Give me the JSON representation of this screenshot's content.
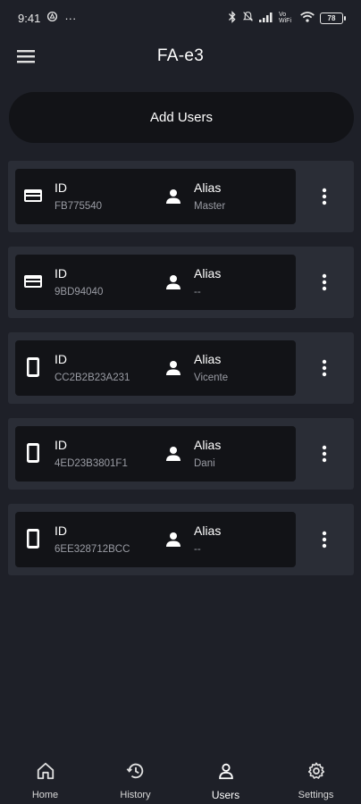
{
  "status_bar": {
    "time": "9:41",
    "overflow": "···",
    "network_label": "Vo WiFi",
    "battery": "78"
  },
  "app_bar": {
    "title": "FA-e3",
    "menu_icon": "hamburger-menu-icon"
  },
  "add_users": {
    "label": "Add Users"
  },
  "users": [
    {
      "type_icon": "card-icon",
      "id_label": "ID",
      "id_value": "FB775540",
      "alias_label": "Alias",
      "alias_value": "Master"
    },
    {
      "type_icon": "card-icon",
      "id_label": "ID",
      "id_value": "9BD94040",
      "alias_label": "Alias",
      "alias_value": "--"
    },
    {
      "type_icon": "phone-icon",
      "id_label": "ID",
      "id_value": "CC2B2B23A231",
      "alias_label": "Alias",
      "alias_value": "Vicente"
    },
    {
      "type_icon": "phone-icon",
      "id_label": "ID",
      "id_value": "4ED23B3801F1",
      "alias_label": "Alias",
      "alias_value": "Dani"
    },
    {
      "type_icon": "phone-icon",
      "id_label": "ID",
      "id_value": "6EE328712BCC",
      "alias_label": "Alias",
      "alias_value": "--"
    }
  ],
  "bottom_nav": {
    "items": [
      {
        "label": "Home",
        "icon": "home-icon"
      },
      {
        "label": "History",
        "icon": "history-icon"
      },
      {
        "label": "Users",
        "icon": "person-icon"
      },
      {
        "label": "Settings",
        "icon": "gear-icon"
      }
    ],
    "active": "Users"
  },
  "colors": {
    "background": "#1e2028",
    "card_outer": "#2a2d36",
    "card_inner": "#121317",
    "secondary_text": "#9a9ca4"
  }
}
